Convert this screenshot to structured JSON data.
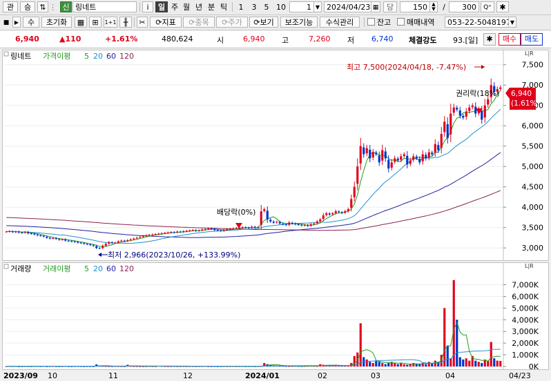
{
  "toolbar1": {
    "btn_gwan": "관",
    "btn_seung": "승",
    "market_badge": "신",
    "stock_name": "링네트",
    "info_btn": "i",
    "period_day": "일",
    "period_week": "주",
    "period_month": "월",
    "period_year": "년",
    "period_min": "분",
    "period_tick": "틱",
    "n1": "1",
    "n3": "3",
    "n5": "5",
    "n10": "10",
    "unit_value": "1",
    "date_value": "2024/04/23",
    "date_label": "당",
    "count_value": "150",
    "slash": "/",
    "total_value": "300",
    "zoom_btn": "Q⁺",
    "phone": "053-22-5048197"
  },
  "toolbar2": {
    "su_btn": "수",
    "reset_btn": "초기화",
    "oneone": "1+1",
    "indicator_btn": "지표",
    "stock_btn": "종목",
    "price_btn": "주가",
    "view_btn": "보기",
    "aux_btn": "보조기능",
    "formula_btn": "수식관리",
    "balance_chk": "잔고",
    "trade_chk": "매매내역"
  },
  "quote": {
    "price": "6,940",
    "change": "▲110",
    "change_pct": "+1.61%",
    "volume": "480,624",
    "open_label": "시",
    "open": "6,940",
    "high_label": "고",
    "high": "7,260",
    "low_label": "저",
    "low": "6,740",
    "strength_label": "체결강도",
    "strength": "93.[일]",
    "buy_btn": "매수",
    "sell_btn": "매도"
  },
  "price_panel": {
    "title": "링네트",
    "legend_ma": "가격이평",
    "legend_periods": [
      "5",
      "20",
      "60",
      "120"
    ],
    "legend_colors": [
      "#1f9e1f",
      "#1e90d0",
      "#2020a0",
      "#8b2252"
    ],
    "ann_high": "최고 7,500(2024/04/18, -7.47%)",
    "ann_low": "최저 2,966(2023/10/26, +133.99%)",
    "ann_dividend": "배당락(0%)",
    "ann_rights": "권리락(18%)",
    "current_price": "6,940",
    "current_pct": "(1.61%)",
    "y_ticks": [
      "7,500",
      "7,000",
      "6,500",
      "6,000",
      "5,500",
      "5,000",
      "4,500",
      "4,000",
      "3,500",
      "3,000"
    ],
    "corner": "L|R"
  },
  "volume_panel": {
    "title": "거래량",
    "legend_ma": "거래이평",
    "legend_periods": [
      "5",
      "20",
      "60",
      "120"
    ],
    "y_ticks": [
      "7,000K",
      "6,000K",
      "5,000K",
      "4,000K",
      "3,000K",
      "2,000K",
      "1,000K",
      "0K"
    ],
    "corner": "L|R"
  },
  "x_axis": {
    "labels": [
      "2023/09",
      "10",
      "11",
      "12",
      "2024/01",
      "02",
      "03",
      "04"
    ],
    "last_date": "04/23"
  },
  "chart_data": [
    {
      "type": "candlestick",
      "title": "링네트",
      "price_range": [
        2800,
        7750
      ],
      "unit": "KRW",
      "months": [
        "2023/09",
        "10",
        "11",
        "12",
        "2024/01",
        "02",
        "03",
        "04"
      ],
      "annotations": {
        "high": {
          "value": 7500,
          "date": "2024/04/18",
          "pct": -7.47
        },
        "low": {
          "value": 2966,
          "date": "2023/10/26",
          "pct": 133.99
        }
      },
      "closes": [
        3400,
        3410,
        3390,
        3400,
        3380,
        3370,
        3390,
        3360,
        3350,
        3330,
        3310,
        3300,
        3280,
        3250,
        3230,
        3240,
        3220,
        3200,
        3210,
        3180,
        3170,
        3160,
        3150,
        3130,
        3120,
        3100,
        3090,
        3070,
        3050,
        3000,
        2990,
        3050,
        3100,
        3140,
        3120,
        3130,
        3160,
        3180,
        3170,
        3190,
        3210,
        3230,
        3250,
        3270,
        3290,
        3310,
        3320,
        3330,
        3340,
        3350,
        3360,
        3370,
        3380,
        3390,
        3380,
        3400,
        3390,
        3410,
        3420,
        3430,
        3440,
        3420,
        3430,
        3450,
        3460,
        3480,
        3470,
        3440,
        3430,
        3420,
        3440,
        3460,
        3470,
        3480,
        3490,
        3500,
        3510,
        3500,
        3490,
        3520,
        3500,
        3510,
        3900,
        3950,
        3700,
        3650,
        3620,
        3640,
        3600,
        3580,
        3560,
        3620,
        3600,
        3580,
        3570,
        3550,
        3560,
        3540,
        3580,
        3600,
        3650,
        3700,
        3800,
        3850,
        3820,
        3850,
        3900,
        3880,
        3860,
        3900,
        3950,
        4200,
        4500,
        5000,
        5500,
        5300,
        5450,
        5200,
        5350,
        5300,
        5100,
        5400,
        5200,
        4950,
        5100,
        5200,
        5150,
        5250,
        5300,
        5050,
        5150,
        5250,
        5200,
        5100,
        5300,
        5200,
        5350,
        5300,
        5550,
        5400,
        5800,
        6100,
        5700,
        6300,
        6450,
        6400,
        6250,
        6200,
        6350,
        6450,
        6500,
        6300,
        6400,
        6150,
        6500,
        6650,
        7000,
        6830,
        6900,
        6940
      ],
      "volume_k_values": [
        20,
        30,
        25,
        40,
        15,
        20,
        30,
        25,
        20,
        35,
        30,
        25,
        40,
        20,
        30,
        35,
        25,
        20,
        30,
        40,
        25,
        20,
        30,
        35,
        28,
        22,
        30,
        25,
        20,
        180,
        50,
        40,
        30,
        25,
        20,
        35,
        30,
        25,
        20,
        150,
        40,
        30,
        25,
        20,
        15,
        20,
        30,
        25,
        20,
        60,
        40,
        30,
        20,
        25,
        30,
        20,
        25,
        30,
        20,
        25,
        30,
        20,
        25,
        30,
        40,
        20,
        25,
        30,
        20,
        25,
        30,
        20,
        25,
        30,
        20,
        25,
        30,
        20,
        25,
        30,
        20,
        25,
        30,
        300,
        200,
        150,
        100,
        80,
        60,
        50,
        40,
        30,
        40,
        50,
        40,
        30,
        40,
        50,
        60,
        50,
        40,
        200,
        150,
        100,
        80,
        60,
        150,
        100,
        80,
        60,
        50,
        300,
        900,
        1200,
        3700,
        800,
        600,
        400,
        300,
        500,
        400,
        300,
        200,
        300,
        400,
        300,
        200,
        300,
        200,
        150,
        200,
        300,
        250,
        200,
        300,
        200,
        400,
        300,
        500,
        400,
        1000,
        5000,
        1800,
        700,
        7400,
        4000,
        800,
        600,
        700,
        500,
        900,
        500,
        400,
        300,
        600,
        500,
        2100,
        700,
        500,
        480
      ]
    }
  ]
}
